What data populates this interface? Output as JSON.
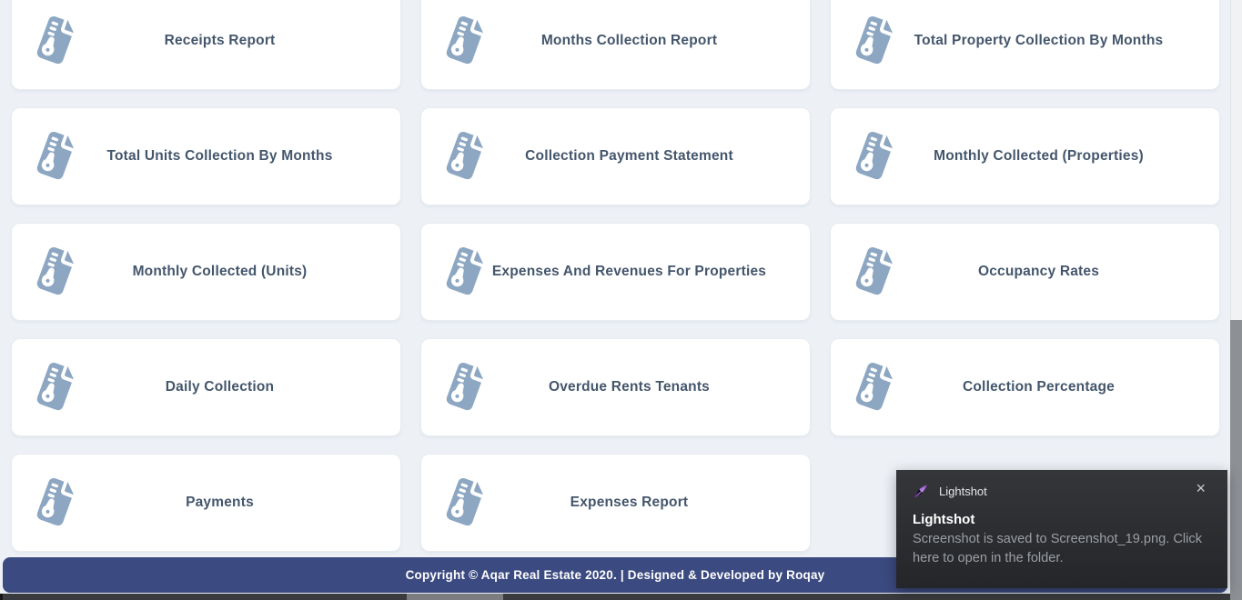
{
  "reports": {
    "items": [
      {
        "label": "Receipts Report"
      },
      {
        "label": "Months Collection Report"
      },
      {
        "label": "Total Property Collection By Months"
      },
      {
        "label": "Total Units Collection By Months"
      },
      {
        "label": "Collection Payment Statement"
      },
      {
        "label": "Monthly Collected (Properties)"
      },
      {
        "label": "Monthly Collected (Units)"
      },
      {
        "label": "Expenses And Revenues For Properties"
      },
      {
        "label": "Occupancy Rates"
      },
      {
        "label": "Daily Collection"
      },
      {
        "label": "Overdue Rents Tenants"
      },
      {
        "label": "Collection Percentage"
      },
      {
        "label": "Payments"
      },
      {
        "label": "Expenses Report"
      }
    ],
    "icon_color": "#8da7c3",
    "label_color": "#44566c"
  },
  "footer": {
    "text": "Copyright © Aqar Real Estate 2020. | Designed & Developed by Roqay",
    "background": "#3b4a80"
  },
  "toast": {
    "app_name": "Lightshot",
    "title": "Lightshot",
    "body": "Screenshot is saved to Screenshot_19.png. Click here to open in the folder.",
    "close_glyph": "×",
    "feather_colors": {
      "light": "#b57ae6",
      "dark": "#7a35c2"
    }
  },
  "scrollbar": {
    "thumb_color": "#8d9196"
  }
}
